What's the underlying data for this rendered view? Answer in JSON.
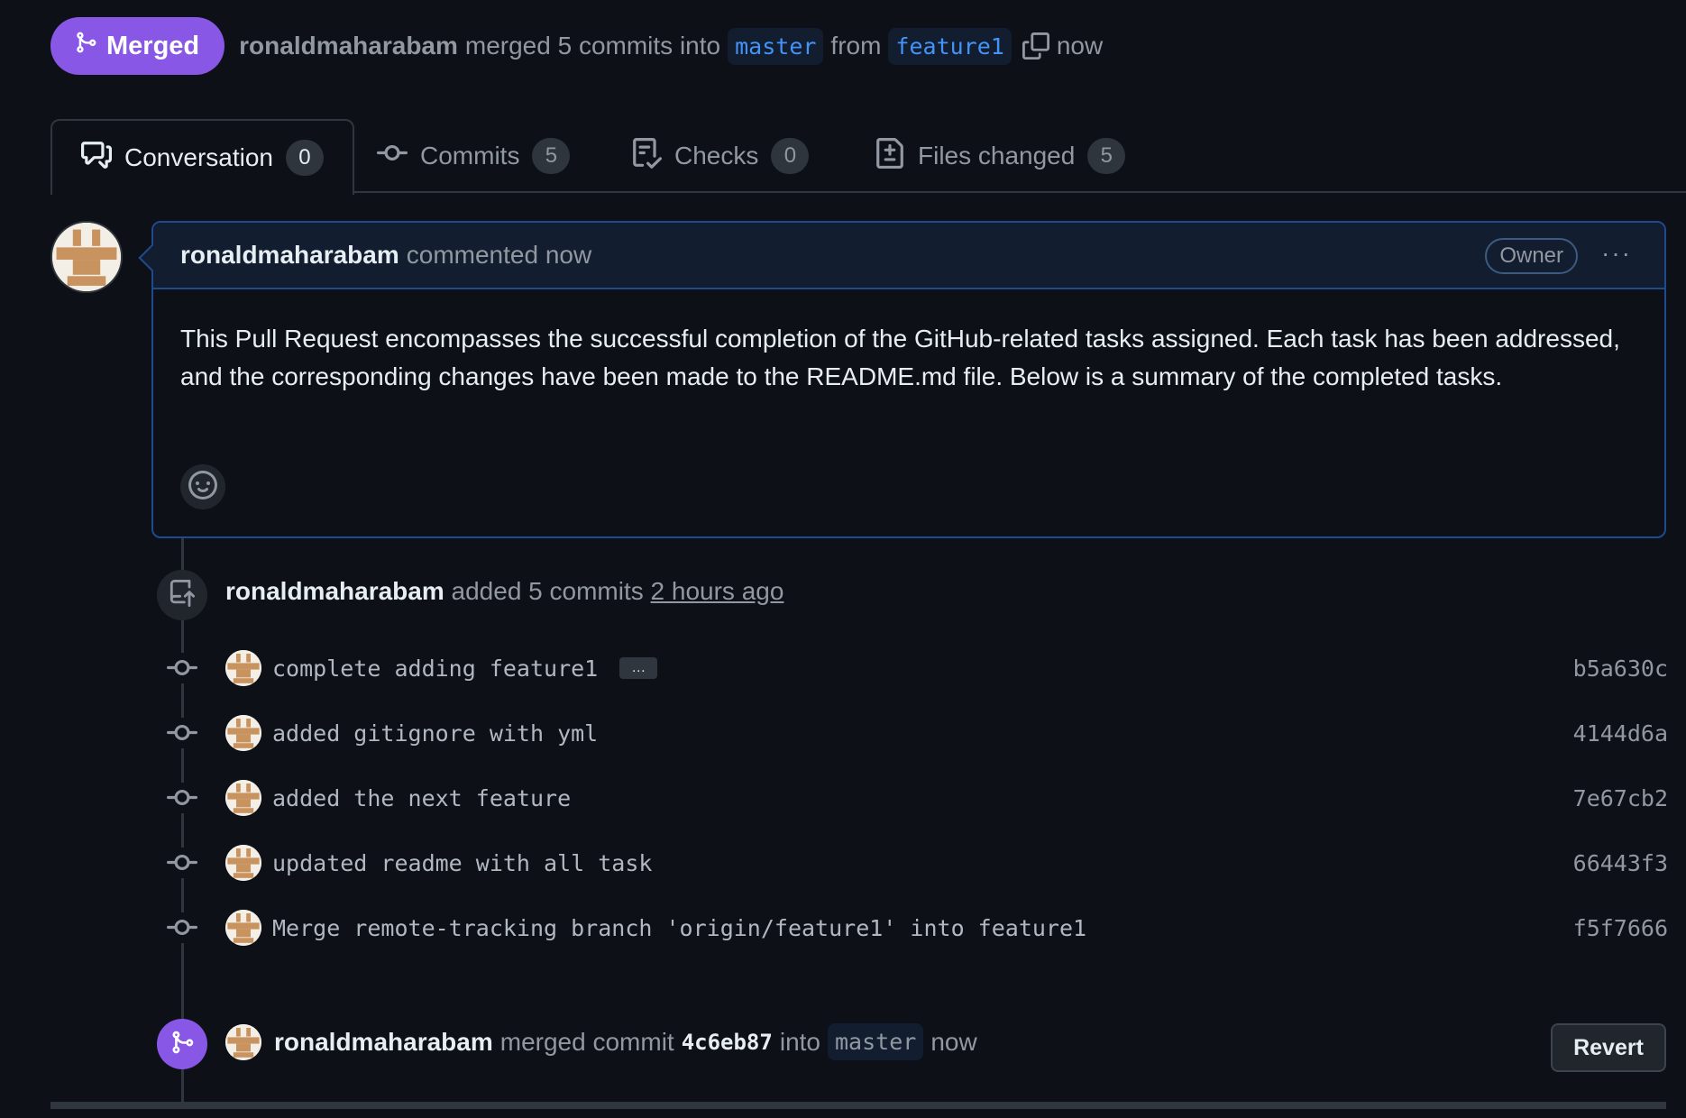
{
  "header": {
    "state_label": "Merged",
    "user": "ronaldmaharabam",
    "action": "merged 5 commits into",
    "base_branch": "master",
    "from_word": "from",
    "head_branch": "feature1",
    "time": "now"
  },
  "tabs": [
    {
      "label": "Conversation",
      "count": "0"
    },
    {
      "label": "Commits",
      "count": "5"
    },
    {
      "label": "Checks",
      "count": "0"
    },
    {
      "label": "Files changed",
      "count": "5"
    }
  ],
  "comment": {
    "user": "ronaldmaharabam",
    "meta": "commented now",
    "badge": "Owner",
    "menu": "···",
    "body": "This Pull Request encompasses the successful completion of the GitHub-related tasks assigned. Each task has been addressed, and the corresponding changes have been made to the README.md file. Below is a summary of the completed tasks."
  },
  "added_event": {
    "user": "ronaldmaharabam",
    "action": "added 5 commits",
    "time": "2 hours ago"
  },
  "commits": [
    {
      "message": "complete adding feature1",
      "sha": "b5a630c",
      "has_more": true,
      "more_label": "…"
    },
    {
      "message": "added gitignore with yml",
      "sha": "4144d6a"
    },
    {
      "message": "added the next feature",
      "sha": "7e67cb2"
    },
    {
      "message": "updated readme with all task",
      "sha": "66443f3"
    },
    {
      "message": "Merge remote-tracking branch 'origin/feature1' into feature1",
      "sha": "f5f7666"
    }
  ],
  "merge_event": {
    "user": "ronaldmaharabam",
    "action": "merged commit",
    "sha": "4c6eb87",
    "into_word": "into",
    "branch": "master",
    "time": "now",
    "revert_label": "Revert"
  },
  "colors": {
    "background": "#0d1117",
    "merged_purple": "#8957e5",
    "link_blue": "#4493f8",
    "comment_border": "#1f4b8e"
  }
}
